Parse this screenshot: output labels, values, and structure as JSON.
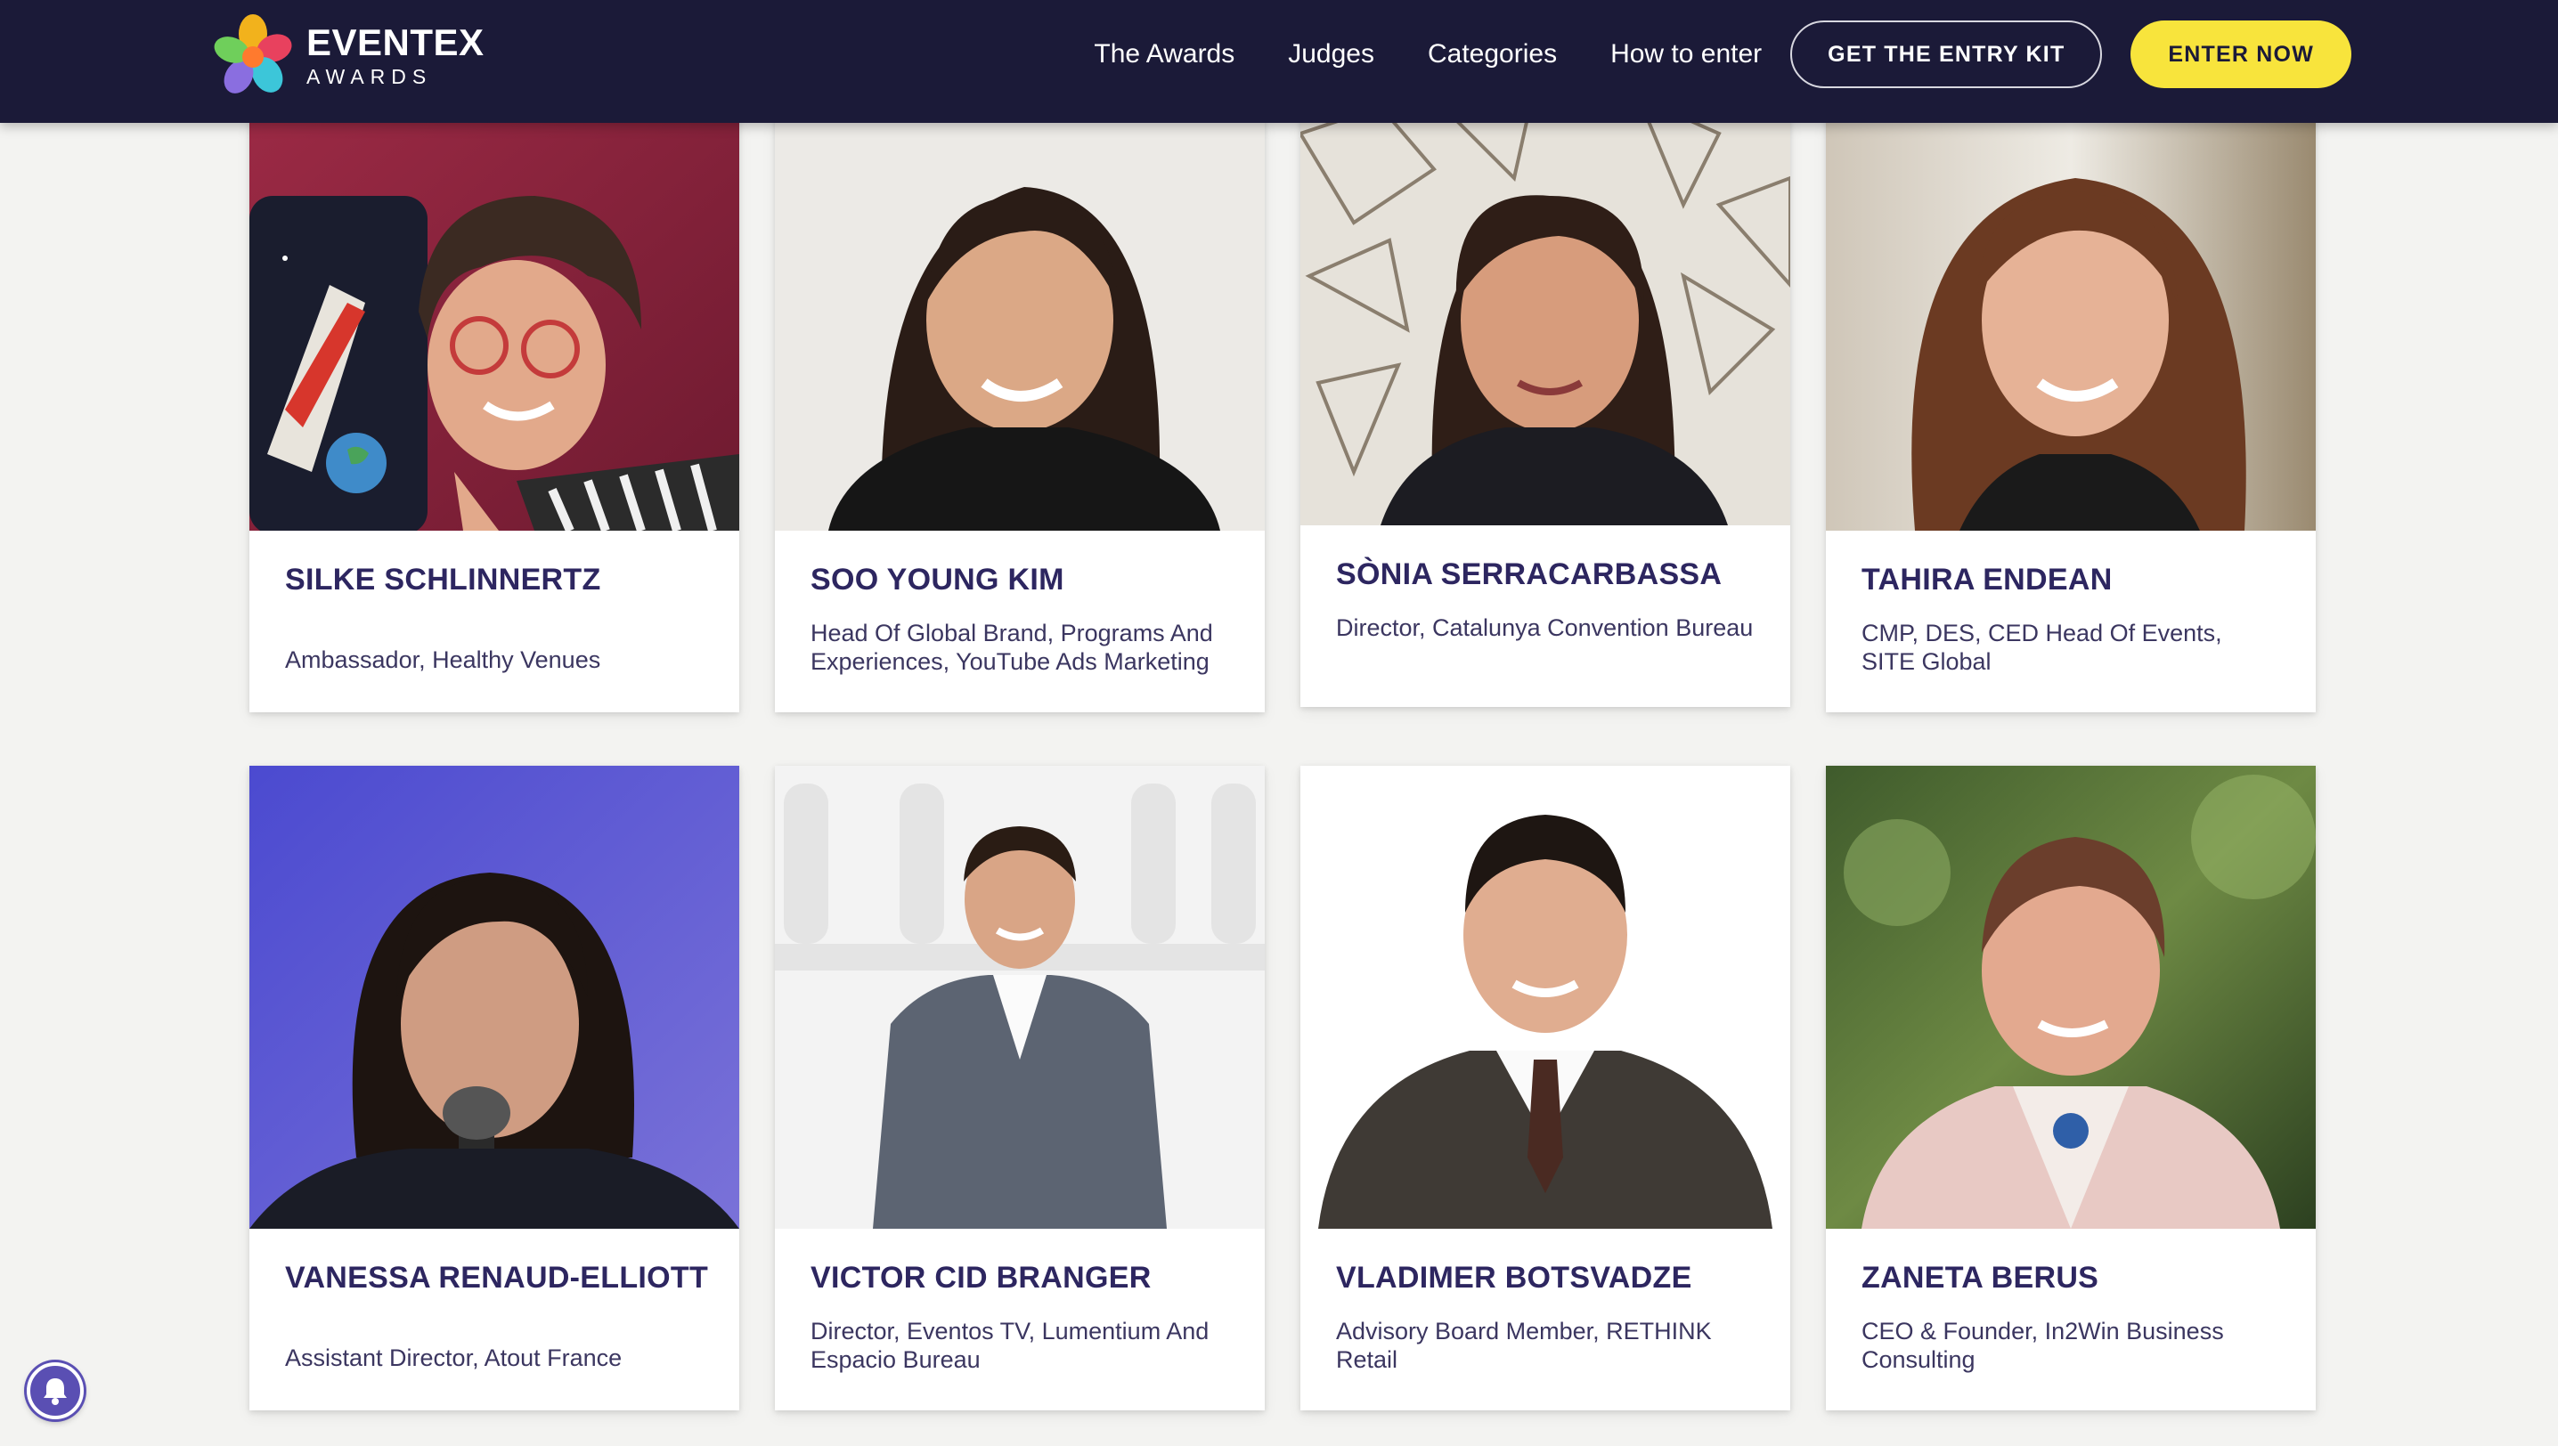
{
  "brand": {
    "name": "EVENTEX",
    "sub": "AWARDS"
  },
  "nav": {
    "links": [
      "The Awards",
      "Judges",
      "Categories",
      "How to enter"
    ],
    "entry_kit": "GET THE ENTRY KIT",
    "enter_now": "ENTER NOW"
  },
  "colors": {
    "header_bg": "#1b1a38",
    "accent_yellow": "#f8e43c",
    "name_color": "#2d2660",
    "page_bg": "#f3f3f1"
  },
  "judges": [
    {
      "name": "SILKE SCHLINNERTZ",
      "role": "Ambassador, Healthy Venues"
    },
    {
      "name": "SOO YOUNG KIM",
      "role": "Head Of Global Brand, Programs And Experiences, YouTube Ads Marketing"
    },
    {
      "name": "SÒNIA SERRACARBASSA",
      "role": "Director, Catalunya Convention Bureau"
    },
    {
      "name": "TAHIRA ENDEAN",
      "role": "CMP, DES, CED Head Of Events, SITE Global"
    },
    {
      "name": "VANESSA RENAUD-ELLIOTT",
      "role": "Assistant Director, Atout France"
    },
    {
      "name": "VICTOR CID BRANGER",
      "role": "Director, Eventos TV, Lumentium And Espacio Bureau"
    },
    {
      "name": "VLADIMER BOTSVADZE",
      "role": "Advisory Board Member, RETHINK Retail"
    },
    {
      "name": "ZANETA BERUS",
      "role": "CEO & Founder, In2Win Business Consulting"
    }
  ],
  "icons": {
    "logo": "eventex-flower-logo",
    "notification": "bell-icon"
  }
}
